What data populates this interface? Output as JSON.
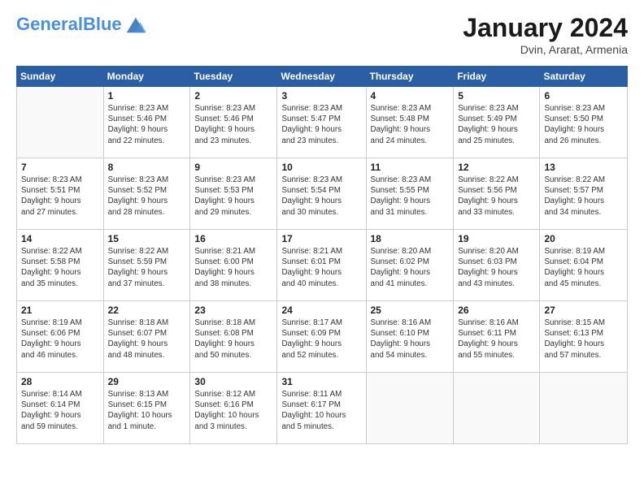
{
  "header": {
    "logo_line1": "General",
    "logo_line2": "Blue",
    "month": "January 2024",
    "location": "Dvin, Ararat, Armenia"
  },
  "weekdays": [
    "Sunday",
    "Monday",
    "Tuesday",
    "Wednesday",
    "Thursday",
    "Friday",
    "Saturday"
  ],
  "weeks": [
    [
      {
        "day": "",
        "info": ""
      },
      {
        "day": "1",
        "info": "Sunrise: 8:23 AM\nSunset: 5:46 PM\nDaylight: 9 hours\nand 22 minutes."
      },
      {
        "day": "2",
        "info": "Sunrise: 8:23 AM\nSunset: 5:46 PM\nDaylight: 9 hours\nand 23 minutes."
      },
      {
        "day": "3",
        "info": "Sunrise: 8:23 AM\nSunset: 5:47 PM\nDaylight: 9 hours\nand 23 minutes."
      },
      {
        "day": "4",
        "info": "Sunrise: 8:23 AM\nSunset: 5:48 PM\nDaylight: 9 hours\nand 24 minutes."
      },
      {
        "day": "5",
        "info": "Sunrise: 8:23 AM\nSunset: 5:49 PM\nDaylight: 9 hours\nand 25 minutes."
      },
      {
        "day": "6",
        "info": "Sunrise: 8:23 AM\nSunset: 5:50 PM\nDaylight: 9 hours\nand 26 minutes."
      }
    ],
    [
      {
        "day": "7",
        "info": "Sunrise: 8:23 AM\nSunset: 5:51 PM\nDaylight: 9 hours\nand 27 minutes."
      },
      {
        "day": "8",
        "info": "Sunrise: 8:23 AM\nSunset: 5:52 PM\nDaylight: 9 hours\nand 28 minutes."
      },
      {
        "day": "9",
        "info": "Sunrise: 8:23 AM\nSunset: 5:53 PM\nDaylight: 9 hours\nand 29 minutes."
      },
      {
        "day": "10",
        "info": "Sunrise: 8:23 AM\nSunset: 5:54 PM\nDaylight: 9 hours\nand 30 minutes."
      },
      {
        "day": "11",
        "info": "Sunrise: 8:23 AM\nSunset: 5:55 PM\nDaylight: 9 hours\nand 31 minutes."
      },
      {
        "day": "12",
        "info": "Sunrise: 8:22 AM\nSunset: 5:56 PM\nDaylight: 9 hours\nand 33 minutes."
      },
      {
        "day": "13",
        "info": "Sunrise: 8:22 AM\nSunset: 5:57 PM\nDaylight: 9 hours\nand 34 minutes."
      }
    ],
    [
      {
        "day": "14",
        "info": "Sunrise: 8:22 AM\nSunset: 5:58 PM\nDaylight: 9 hours\nand 35 minutes."
      },
      {
        "day": "15",
        "info": "Sunrise: 8:22 AM\nSunset: 5:59 PM\nDaylight: 9 hours\nand 37 minutes."
      },
      {
        "day": "16",
        "info": "Sunrise: 8:21 AM\nSunset: 6:00 PM\nDaylight: 9 hours\nand 38 minutes."
      },
      {
        "day": "17",
        "info": "Sunrise: 8:21 AM\nSunset: 6:01 PM\nDaylight: 9 hours\nand 40 minutes."
      },
      {
        "day": "18",
        "info": "Sunrise: 8:20 AM\nSunset: 6:02 PM\nDaylight: 9 hours\nand 41 minutes."
      },
      {
        "day": "19",
        "info": "Sunrise: 8:20 AM\nSunset: 6:03 PM\nDaylight: 9 hours\nand 43 minutes."
      },
      {
        "day": "20",
        "info": "Sunrise: 8:19 AM\nSunset: 6:04 PM\nDaylight: 9 hours\nand 45 minutes."
      }
    ],
    [
      {
        "day": "21",
        "info": "Sunrise: 8:19 AM\nSunset: 6:06 PM\nDaylight: 9 hours\nand 46 minutes."
      },
      {
        "day": "22",
        "info": "Sunrise: 8:18 AM\nSunset: 6:07 PM\nDaylight: 9 hours\nand 48 minutes."
      },
      {
        "day": "23",
        "info": "Sunrise: 8:18 AM\nSunset: 6:08 PM\nDaylight: 9 hours\nand 50 minutes."
      },
      {
        "day": "24",
        "info": "Sunrise: 8:17 AM\nSunset: 6:09 PM\nDaylight: 9 hours\nand 52 minutes."
      },
      {
        "day": "25",
        "info": "Sunrise: 8:16 AM\nSunset: 6:10 PM\nDaylight: 9 hours\nand 54 minutes."
      },
      {
        "day": "26",
        "info": "Sunrise: 8:16 AM\nSunset: 6:11 PM\nDaylight: 9 hours\nand 55 minutes."
      },
      {
        "day": "27",
        "info": "Sunrise: 8:15 AM\nSunset: 6:13 PM\nDaylight: 9 hours\nand 57 minutes."
      }
    ],
    [
      {
        "day": "28",
        "info": "Sunrise: 8:14 AM\nSunset: 6:14 PM\nDaylight: 9 hours\nand 59 minutes."
      },
      {
        "day": "29",
        "info": "Sunrise: 8:13 AM\nSunset: 6:15 PM\nDaylight: 10 hours\nand 1 minute."
      },
      {
        "day": "30",
        "info": "Sunrise: 8:12 AM\nSunset: 6:16 PM\nDaylight: 10 hours\nand 3 minutes."
      },
      {
        "day": "31",
        "info": "Sunrise: 8:11 AM\nSunset: 6:17 PM\nDaylight: 10 hours\nand 5 minutes."
      },
      {
        "day": "",
        "info": ""
      },
      {
        "day": "",
        "info": ""
      },
      {
        "day": "",
        "info": ""
      }
    ]
  ]
}
